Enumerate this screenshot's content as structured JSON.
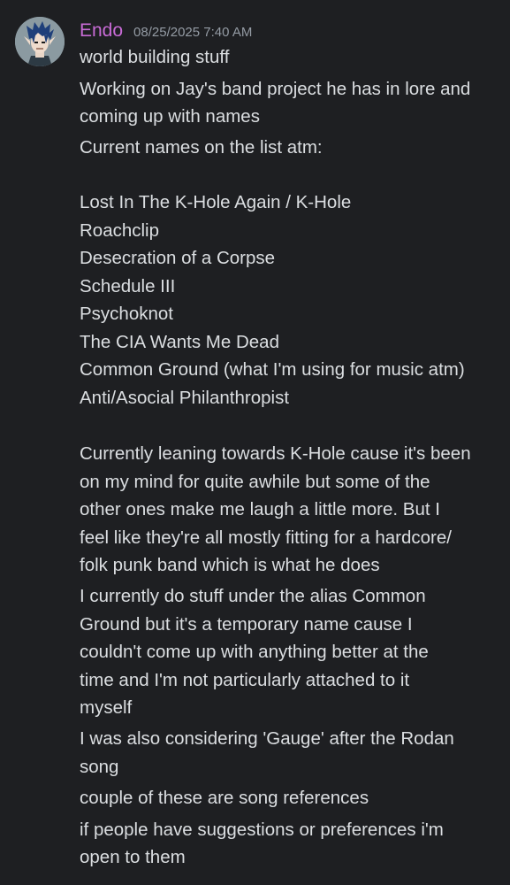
{
  "message": {
    "author": "Endo",
    "timestamp": "08/25/2025 7:40 AM",
    "colors": {
      "background": "#1e1f22",
      "username": "#c86bd6",
      "text": "#dbdee1",
      "timestamp": "#949ba4"
    },
    "lines": [
      "world building stuff",
      "Working on Jay's band project he has in lore and",
      "coming up with names",
      "Current names on the list atm:",
      "Lost In The K-Hole Again / K-Hole",
      "Roachclip",
      "Desecration of a Corpse",
      "Schedule III",
      "Psychoknot",
      "The CIA Wants Me Dead",
      "Common Ground (what I'm using for music atm)",
      "Anti/Asocial Philanthropist",
      "Currently leaning towards K-Hole cause it's been",
      "on my mind for quite awhile but some of the",
      "other ones make me laugh a little more. But I",
      "feel like they're all mostly fitting for a hardcore/",
      "folk punk band which is what he does",
      "I currently do stuff under the alias Common",
      "Ground but it's a temporary name cause I",
      "couldn't come up with anything better at the",
      "time and I'm not particularly attached to it",
      "myself",
      "I was also considering 'Gauge' after the Rodan",
      "song",
      "couple of these are song references",
      "if people have suggestions or preferences i'm",
      "open to them"
    ]
  }
}
